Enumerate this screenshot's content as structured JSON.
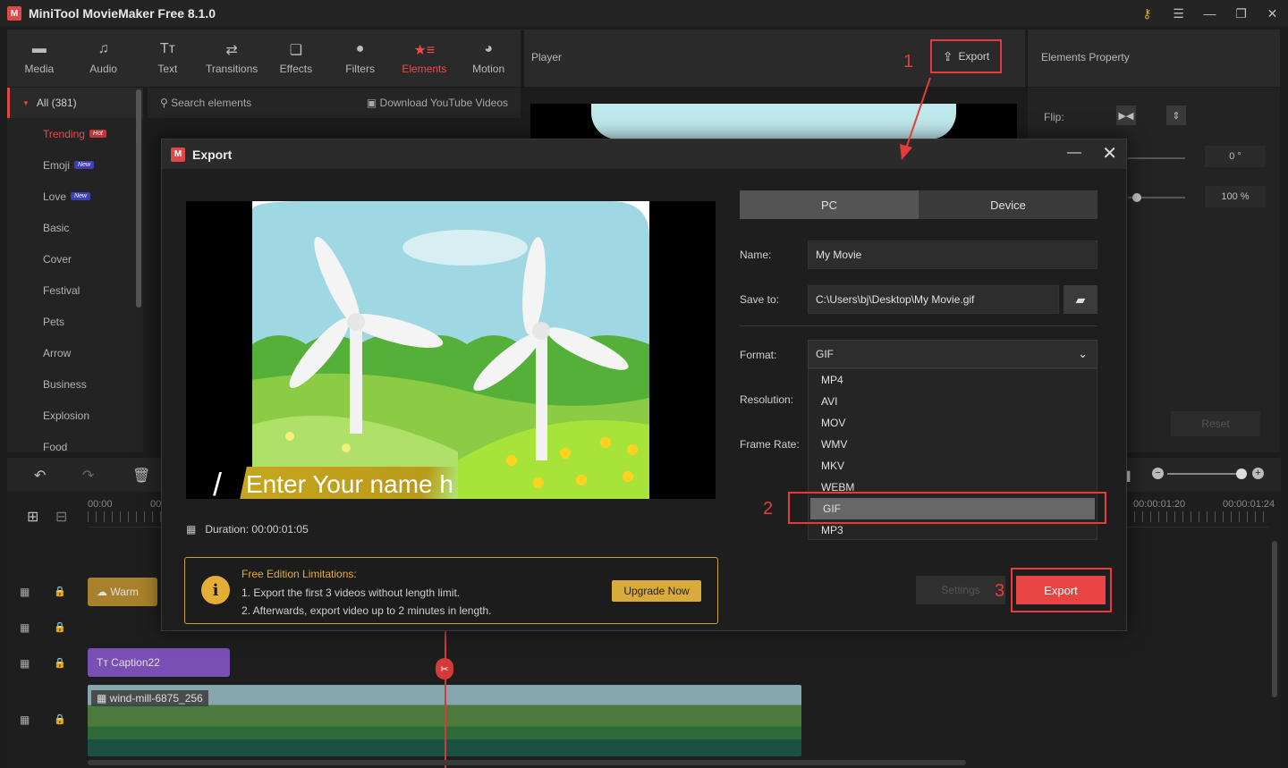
{
  "app": {
    "title": "MiniTool MovieMaker Free 8.1.0"
  },
  "toolbar": {
    "items": [
      {
        "label": "Media",
        "icon": "folder-icon"
      },
      {
        "label": "Audio",
        "icon": "music-icon"
      },
      {
        "label": "Text",
        "icon": "text-icon"
      },
      {
        "label": "Transitions",
        "icon": "transitions-icon"
      },
      {
        "label": "Effects",
        "icon": "effects-icon"
      },
      {
        "label": "Filters",
        "icon": "filters-icon"
      },
      {
        "label": "Elements",
        "icon": "elements-icon",
        "active": true
      },
      {
        "label": "Motion",
        "icon": "motion-icon"
      }
    ]
  },
  "categories": {
    "all_label": "All (381)",
    "items": [
      {
        "label": "Trending",
        "badge": "Hot"
      },
      {
        "label": "Emoji",
        "badge": "New"
      },
      {
        "label": "Love",
        "badge": "New"
      },
      {
        "label": "Basic"
      },
      {
        "label": "Cover"
      },
      {
        "label": "Festival"
      },
      {
        "label": "Pets"
      },
      {
        "label": "Arrow"
      },
      {
        "label": "Business"
      },
      {
        "label": "Explosion"
      },
      {
        "label": "Food"
      }
    ]
  },
  "search": {
    "placeholder": "Search elements",
    "download_label": "Download YouTube Videos"
  },
  "player": {
    "label": "Player",
    "export_label": "Export"
  },
  "properties": {
    "title": "Elements Property",
    "flip_label": "Flip:",
    "rotation_value": "0 °",
    "scale_value": "100 %",
    "reset_label": "Reset"
  },
  "timeline": {
    "ruler": {
      "start": "00:00",
      "second": "00",
      "mark_a": "00:00:01:20",
      "mark_b": "00:00:01:24"
    },
    "clips": {
      "warm": "Warm",
      "caption": "Caption22",
      "video": "wind-mill-6875_256"
    }
  },
  "dialog": {
    "title": "Export",
    "preview_overlay_text": "Enter Your name h",
    "duration_label": "Duration:",
    "duration_value": "00:00:01:05",
    "tabs": {
      "pc": "PC",
      "device": "Device"
    },
    "name_label": "Name:",
    "name_value": "My Movie",
    "save_label": "Save to:",
    "save_value": "C:\\Users\\bj\\Desktop\\My Movie.gif",
    "format_label": "Format:",
    "format_value": "GIF",
    "resolution_label": "Resolution:",
    "frame_rate_label": "Frame Rate:",
    "format_options": [
      "MP4",
      "AVI",
      "MOV",
      "WMV",
      "MKV",
      "WEBM",
      "GIF",
      "MP3"
    ],
    "notice": {
      "title": "Free Edition Limitations:",
      "line1": "1. Export the first 3 videos without length limit.",
      "line2": "2. Afterwards, export video up to 2 minutes in length.",
      "upgrade_label": "Upgrade Now"
    },
    "settings_label": "Settings",
    "export_label": "Export"
  },
  "annotations": {
    "step1": "1",
    "step2": "2",
    "step3": "3"
  },
  "colors": {
    "accent": "#e94444",
    "highlight": "#e53b3b",
    "notice": "#e2ae36"
  }
}
